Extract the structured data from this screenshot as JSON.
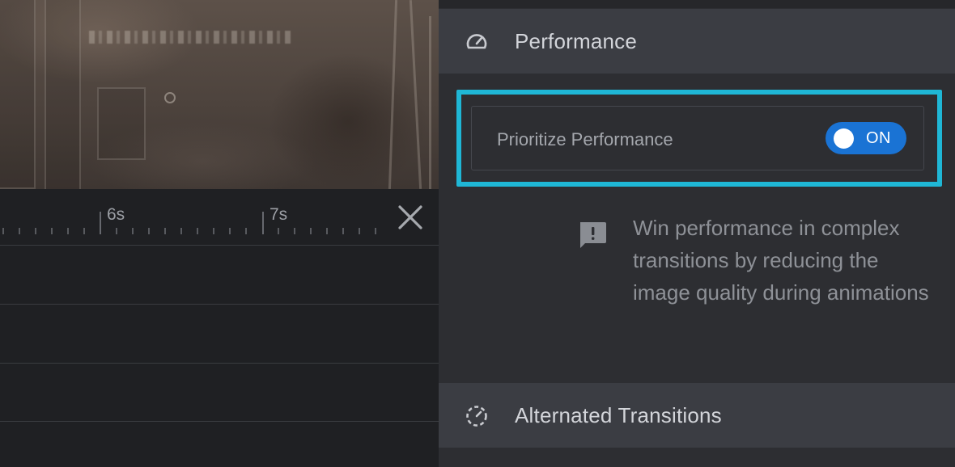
{
  "timeline": {
    "ruler_labels": [
      "6s",
      "7s"
    ],
    "close_icon": "close-icon"
  },
  "panel": {
    "performance_section": {
      "title": "Performance",
      "icon": "speedometer-icon"
    },
    "prioritize_toggle": {
      "label": "Prioritize Performance",
      "state": "ON",
      "enabled": true,
      "color": "#1a73d4"
    },
    "info": {
      "icon": "alert-message-icon",
      "text": "Win performance in complex transitions by reducing the image quality during animations"
    },
    "alternated_section": {
      "title": "Alternated Transitions",
      "icon": "dashed-timer-icon"
    }
  },
  "colors": {
    "highlight": "#1fb7d6",
    "panel_bg": "#2d2e32",
    "section_header_bg": "#3b3d43"
  }
}
